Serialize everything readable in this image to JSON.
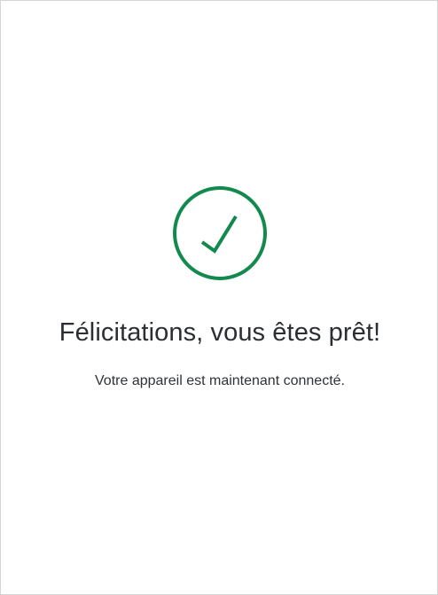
{
  "success": {
    "icon": "checkmark-circle-icon",
    "color": "#138a4d",
    "title": "Félicitations, vous êtes prêt!",
    "message": "Votre appareil est maintenant connecté."
  }
}
